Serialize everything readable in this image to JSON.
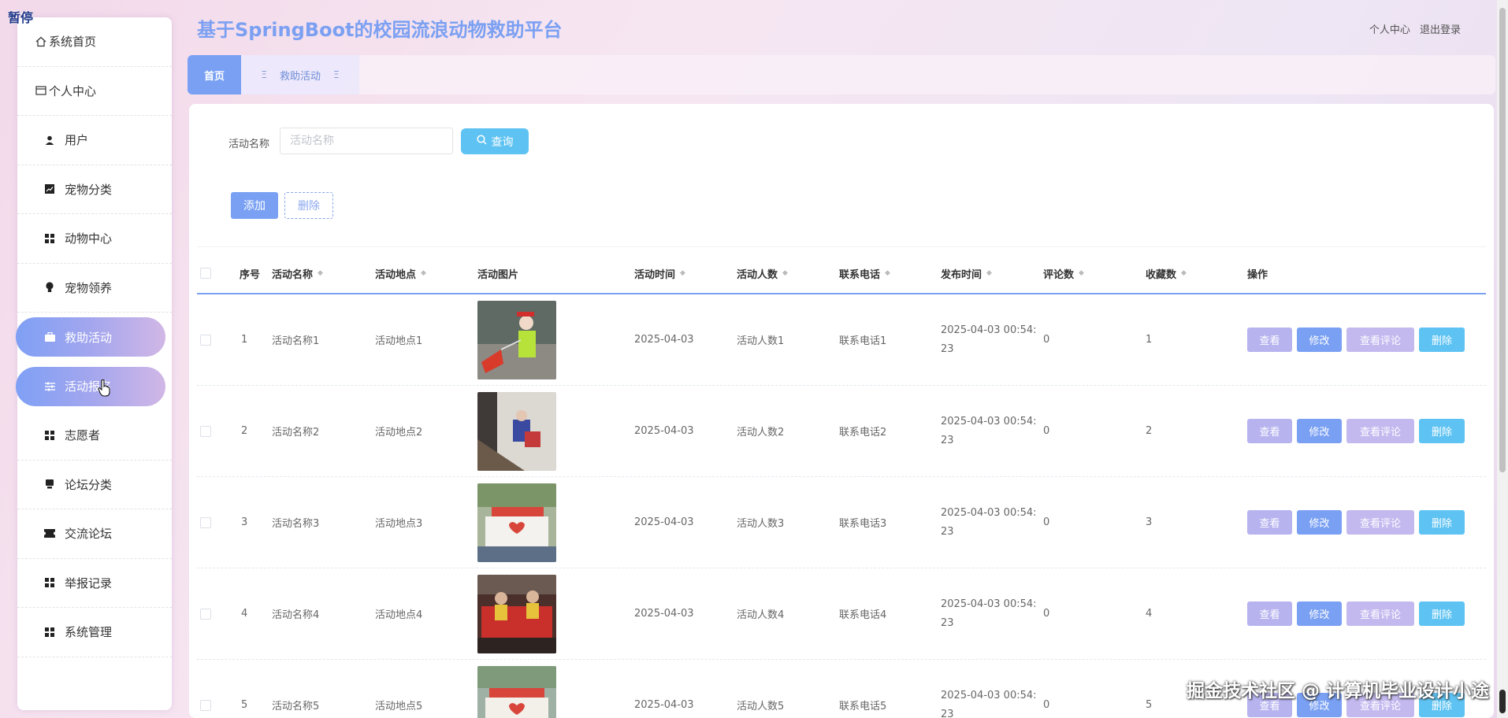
{
  "overlay": {
    "pause_label": "暂停"
  },
  "header": {
    "title": "基于SpringBoot的校园流浪动物救助平台",
    "links": [
      "个人中心",
      "退出登录"
    ]
  },
  "sidebar": {
    "items": [
      {
        "label": "系统首页",
        "icon": "home-icon"
      },
      {
        "label": "个人中心",
        "icon": "profile-icon"
      },
      {
        "label": "用户",
        "icon": "user-icon"
      },
      {
        "label": "宠物分类",
        "icon": "chart-icon"
      },
      {
        "label": "动物中心",
        "icon": "grid-icon"
      },
      {
        "label": "宠物领养",
        "icon": "bulb-icon"
      },
      {
        "label": "救助活动",
        "icon": "briefcase-icon",
        "active": true
      },
      {
        "label": "活动报名",
        "icon": "sliders-icon",
        "active": true
      },
      {
        "label": "志愿者",
        "icon": "grid-icon"
      },
      {
        "label": "论坛分类",
        "icon": "monitor-icon"
      },
      {
        "label": "交流论坛",
        "icon": "ticket-icon"
      },
      {
        "label": "举报记录",
        "icon": "grid-icon"
      },
      {
        "label": "系统管理",
        "icon": "grid-icon"
      }
    ]
  },
  "tabs": [
    {
      "label": "首页",
      "active": true
    },
    {
      "label": "救助活动",
      "active": false
    }
  ],
  "search": {
    "label": "活动名称",
    "placeholder": "活动名称",
    "value": "",
    "button_label": "查询"
  },
  "toolbar": {
    "add_label": "添加",
    "delete_label": "删除"
  },
  "table": {
    "columns": [
      "序号",
      "活动名称",
      "活动地点",
      "活动图片",
      "活动时间",
      "活动人数",
      "联系电话",
      "发布时间",
      "评论数",
      "收藏数",
      "操作"
    ],
    "rows": [
      {
        "index": "1",
        "name": "活动名称1",
        "place": "活动地点1",
        "time": "2025-04-03",
        "people": "活动人数1",
        "phone": "联系电话1",
        "pub_date": "2025-04-03 00:54:",
        "pub_tail": "23",
        "comments": "0",
        "favorites": "1"
      },
      {
        "index": "2",
        "name": "活动名称2",
        "place": "活动地点2",
        "time": "2025-04-03",
        "people": "活动人数2",
        "phone": "联系电话2",
        "pub_date": "2025-04-03 00:54:",
        "pub_tail": "23",
        "comments": "0",
        "favorites": "2"
      },
      {
        "index": "3",
        "name": "活动名称3",
        "place": "活动地点3",
        "time": "2025-04-03",
        "people": "活动人数3",
        "phone": "联系电话3",
        "pub_date": "2025-04-03 00:54:",
        "pub_tail": "23",
        "comments": "0",
        "favorites": "3"
      },
      {
        "index": "4",
        "name": "活动名称4",
        "place": "活动地点4",
        "time": "2025-04-03",
        "people": "活动人数4",
        "phone": "联系电话4",
        "pub_date": "2025-04-03 00:54:",
        "pub_tail": "23",
        "comments": "0",
        "favorites": "4"
      },
      {
        "index": "5",
        "name": "活动名称5",
        "place": "活动地点5",
        "time": "2025-04-03",
        "people": "活动人数5",
        "phone": "联系电话5",
        "pub_date": "2025-04-03 00:54:",
        "pub_tail": "23",
        "comments": "0",
        "favorites": "5"
      }
    ],
    "actions": {
      "view": "查看",
      "edit": "修改",
      "view_comments": "查看评论",
      "delete": "删除"
    }
  },
  "watermark": "掘金技术社区 @ 计算机毕业设计小途",
  "colors": {
    "accent": "#7aa0f3",
    "title": "#7ba0f2",
    "search_button": "#5ec3f2",
    "view_button": "#b6b3ef",
    "comments_button": "#c3b9ef"
  }
}
